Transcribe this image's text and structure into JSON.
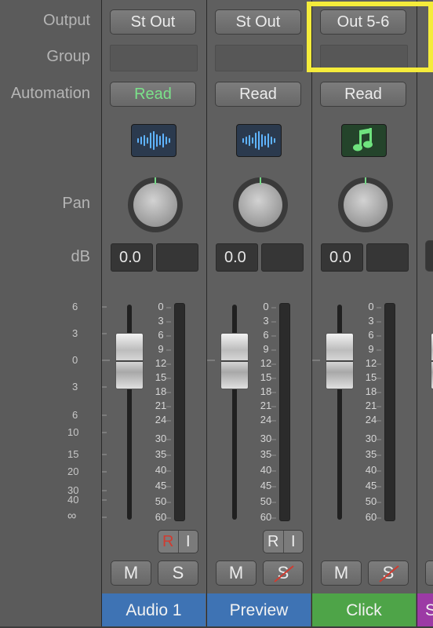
{
  "colors": {
    "read_active": "#7be28a",
    "highlight": "#f5ec3b",
    "rec_red": "#d03b30",
    "name_audio1": "#3e73b4",
    "name_preview": "#3e73b4",
    "name_click": "#4ea448",
    "name_next": "#9c3aa5"
  },
  "row_labels": {
    "output": "Output",
    "group": "Group",
    "automation": "Automation",
    "pan": "Pan",
    "db": "dB"
  },
  "fader_scale_left": [
    "6",
    "3",
    "0",
    "3",
    "6",
    "10",
    "15",
    "20",
    "30",
    "40",
    "∞"
  ],
  "meter_scale": [
    "0",
    "3",
    "6",
    "9",
    "12",
    "15",
    "18",
    "21",
    "24",
    "30",
    "35",
    "40",
    "45",
    "50",
    "60"
  ],
  "channels": [
    {
      "name": "Audio 1",
      "output": "St Out",
      "automation": "Read",
      "automation_active": true,
      "plugin_icon": "audio-waveform-icon",
      "volume_db": "0.0",
      "rec_label": "R",
      "input_label": "I",
      "mute_label": "M",
      "solo_label": "S"
    },
    {
      "name": "Preview",
      "output": "St Out",
      "automation": "Read",
      "automation_active": false,
      "plugin_icon": "audio-waveform-icon",
      "volume_db": "0.0",
      "rec_label": "R",
      "input_label": "I",
      "mute_label": "M",
      "solo_label": "S"
    },
    {
      "name": "Click",
      "output": "Out 5-6",
      "automation": "Read",
      "automation_active": false,
      "plugin_icon": "music-note-icon",
      "volume_db": "0.0",
      "mute_label": "M",
      "solo_label": "S"
    },
    {
      "name": "S"
    }
  ]
}
